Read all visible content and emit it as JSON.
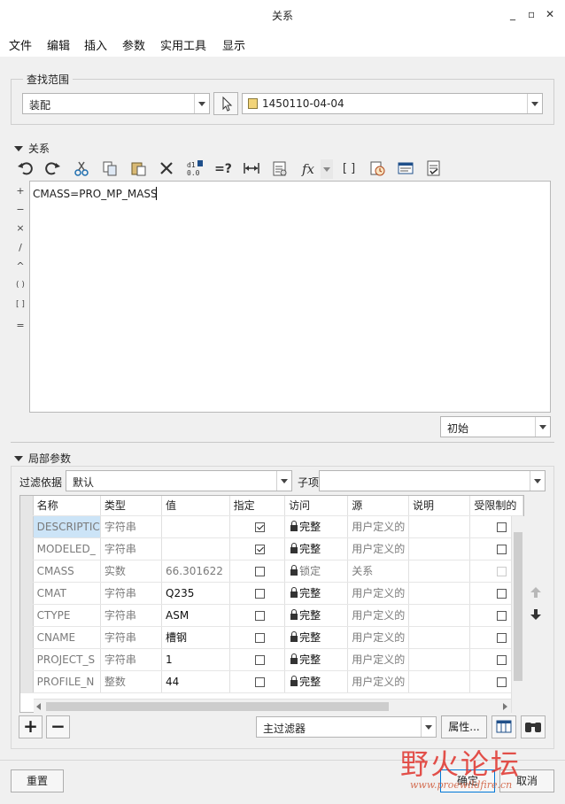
{
  "window": {
    "title": "关系",
    "minimize": "_",
    "maximize": "▫",
    "close": "✕"
  },
  "menu": [
    "文件",
    "编辑",
    "插入",
    "参数",
    "实用工具",
    "显示"
  ],
  "lookin": {
    "group_label": "查找范围",
    "scope_value": "装配",
    "model_value": "1450110-04-04"
  },
  "relations": {
    "section_label": "关系",
    "toolbar_icons": [
      "undo-icon",
      "redo-icon",
      "cut-icon",
      "copy-icon",
      "paste-icon",
      "delete-icon",
      "show-values-icon",
      "evaluate-icon",
      "units-icon",
      "sort-icon",
      "function-icon",
      "brackets-icon",
      "verify-icon",
      "insert-parameter-icon",
      "settings-icon"
    ],
    "operators": [
      "+",
      "−",
      "×",
      "/",
      "^",
      "( )",
      "[ ]",
      "="
    ],
    "text": "CMASS=PRO_MP_MASS",
    "initial_value": "初始"
  },
  "local_params": {
    "section_label": "局部参数",
    "filter_label": "过滤依据",
    "filter_value": "默认",
    "subitem_label": "子项",
    "subitem_value": "",
    "columns": [
      "名称",
      "类型",
      "值",
      "指定",
      "访问",
      "源",
      "说明",
      "受限制的"
    ],
    "rows": [
      {
        "name": "DESCRIPTIC",
        "type": "字符串",
        "value": "",
        "designated": true,
        "access": "完整",
        "source": "用户定义的",
        "desc": "",
        "locked_access": false,
        "selected": true
      },
      {
        "name": "MODELED_",
        "type": "字符串",
        "value": "",
        "designated": true,
        "access": "完整",
        "source": "用户定义的",
        "desc": ""
      },
      {
        "name": "CMASS",
        "type": "实数",
        "value": "66.301622",
        "designated": false,
        "access": "锁定",
        "source": "关系",
        "desc": "",
        "disabled": true
      },
      {
        "name": "CMAT",
        "type": "字符串",
        "value": "Q235",
        "designated": false,
        "access": "完整",
        "source": "用户定义的",
        "desc": ""
      },
      {
        "name": "CTYPE",
        "type": "字符串",
        "value": "ASM",
        "designated": false,
        "access": "完整",
        "source": "用户定义的",
        "desc": ""
      },
      {
        "name": "CNAME",
        "type": "字符串",
        "value": "槽钢",
        "designated": false,
        "access": "完整",
        "source": "用户定义的",
        "desc": ""
      },
      {
        "name": "PROJECT_S",
        "type": "字符串",
        "value": "1",
        "designated": false,
        "access": "完整",
        "source": "用户定义的",
        "desc": ""
      },
      {
        "name": "PROFILE_N",
        "type": "整数",
        "value": "44",
        "designated": false,
        "access": "完整",
        "source": "用户定义的",
        "desc": ""
      }
    ],
    "add_label": "+",
    "remove_label": "−",
    "main_filter_value": "主过滤器",
    "properties_label": "属性..."
  },
  "buttons": {
    "reset": "重置",
    "ok": "确定",
    "cancel": "取消"
  },
  "watermark": {
    "text": "野火论坛",
    "url": "www.proewildfire.cn"
  }
}
